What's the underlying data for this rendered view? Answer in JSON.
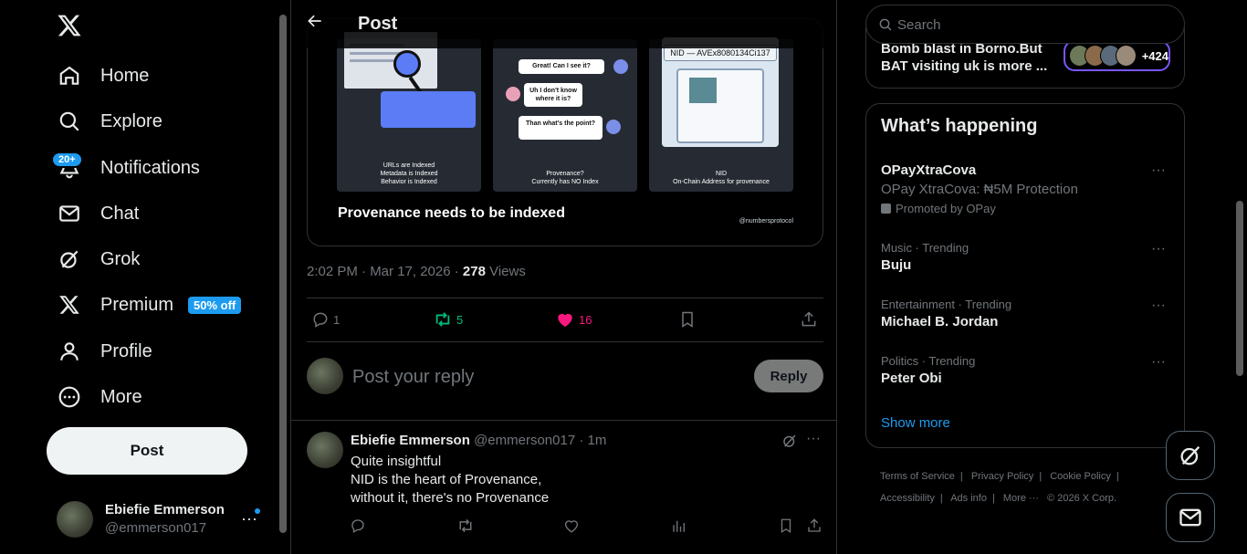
{
  "nav": {
    "logo": "x-logo",
    "items": [
      {
        "label": "Home",
        "icon": "home-icon"
      },
      {
        "label": "Explore",
        "icon": "search-icon"
      },
      {
        "label": "Notifications",
        "icon": "bell-icon"
      },
      {
        "label": "Chat",
        "icon": "mail-icon"
      },
      {
        "label": "Grok",
        "icon": "grok-icon"
      },
      {
        "label": "Premium",
        "icon": "x-icon"
      },
      {
        "label": "Profile",
        "icon": "person-icon"
      },
      {
        "label": "More",
        "icon": "more-circle-icon"
      }
    ],
    "notifications_badge": "20+",
    "premium_badge": "50% off",
    "post_button": "Post"
  },
  "account": {
    "name": "Ebiefie Emmerson",
    "handle": "@emmerson017"
  },
  "header": {
    "title": "Post"
  },
  "media": {
    "panel1_caption": [
      "URLs are Indexed",
      "Metadata is Indexed",
      "Behavior is Indexed"
    ],
    "panel2_bubbles": [
      "Great! Can I see it?",
      "Uh I don't know where it is?",
      "Than what's the point?"
    ],
    "panel2_caption": [
      "Provenance?",
      "Currently has NO Index"
    ],
    "panel3_nid": "NID — AVEx8080134Ci137",
    "panel3_caption": [
      "NID",
      "On-Chain Address for provenance"
    ],
    "caption": "Provenance needs to be  indexed",
    "credit": "@numbersprotocol"
  },
  "post_meta": {
    "time": "2:02 PM · Mar 17, 2026 · ",
    "views_count": "278",
    "views_label": " Views"
  },
  "actions": {
    "replies": "1",
    "reposts": "5",
    "likes": "16"
  },
  "compose": {
    "placeholder": "Post your reply",
    "button": "Reply"
  },
  "reply": {
    "name": "Ebiefie Emmerson",
    "handle_time": "@emmerson017 · 1m",
    "lines": [
      "Quite insightful",
      "NID is the heart of Provenance,",
      "without it, there's no Provenance"
    ]
  },
  "search": {
    "placeholder": "Search"
  },
  "top_news": {
    "lines": [
      "Bomb blast in Borno.But",
      "BAT visiting uk is more ..."
    ],
    "count": "+424"
  },
  "whats_happening": {
    "title": "What’s happening",
    "promoted": {
      "name": "OPayXtraCova",
      "desc": "OPay XtraCova: ₦5M Protection",
      "promo": "Promoted by OPay"
    },
    "trends": [
      {
        "context": "Music · Trending",
        "name": "Buju"
      },
      {
        "context": "Entertainment · Trending",
        "name": "Michael B. Jordan"
      },
      {
        "context": "Politics · Trending",
        "name": "Peter Obi"
      }
    ],
    "show_more": "Show more"
  },
  "footer": {
    "links": [
      "Terms of Service",
      "|",
      "Privacy Policy",
      "|",
      "Cookie Policy",
      "|",
      "Accessibility",
      "|",
      "Ads info",
      "|",
      "More ···",
      "© 2026 X Corp."
    ]
  },
  "colors": {
    "accent": "#1d9bf0",
    "like": "#f91880",
    "repost": "#00ba7c"
  }
}
